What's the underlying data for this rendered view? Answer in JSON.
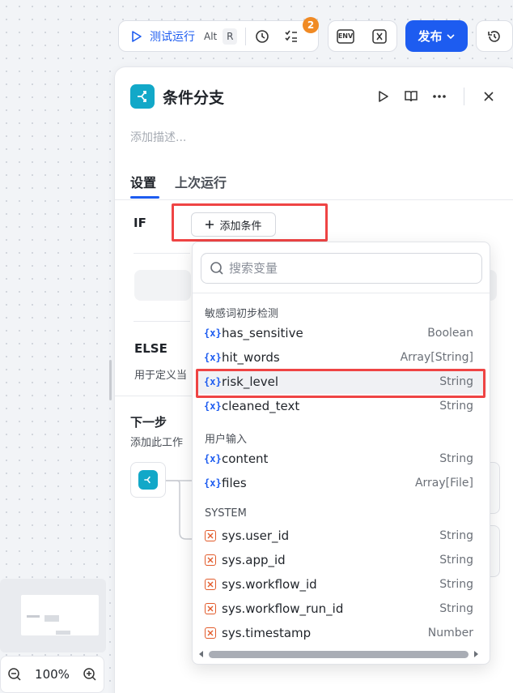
{
  "toolbar": {
    "run_label": "测试运行",
    "shortcut_keys": [
      "Alt",
      "R"
    ],
    "badge_count": "2",
    "env_label": "ENV",
    "publish_label": "发布"
  },
  "panel": {
    "title": "条件分支",
    "description_placeholder": "添加描述...",
    "tabs": [
      {
        "label": "设置",
        "active": true
      },
      {
        "label": "上次运行",
        "active": false
      }
    ],
    "if_label": "IF",
    "add_condition_label": "添加条件",
    "else_label": "ELSE",
    "else_desc": "用于定义当",
    "next_step_title": "下一步",
    "next_step_desc": "添加此工作"
  },
  "dropdown": {
    "search_placeholder": "搜索变量",
    "groups": [
      {
        "label": "敏感词初步检测",
        "items": [
          {
            "name": "has_sensitive",
            "type": "Boolean"
          },
          {
            "name": "hit_words",
            "type": "Array[String]"
          },
          {
            "name": "risk_level",
            "type": "String"
          },
          {
            "name": "cleaned_text",
            "type": "String"
          }
        ]
      },
      {
        "label": "用户输入",
        "items": [
          {
            "name": "content",
            "type": "String"
          },
          {
            "name": "files",
            "type": "Array[File]"
          }
        ]
      },
      {
        "label": "SYSTEM",
        "items": [
          {
            "name": "sys.user_id",
            "type": "String"
          },
          {
            "name": "sys.app_id",
            "type": "String"
          },
          {
            "name": "sys.workflow_id",
            "type": "String"
          },
          {
            "name": "sys.workflow_run_id",
            "type": "String"
          },
          {
            "name": "sys.timestamp",
            "type": "Number"
          }
        ]
      }
    ],
    "var_icon_text": "{x}"
  },
  "zoom": {
    "level": "100%"
  },
  "colors": {
    "accent": "#1d5cf0",
    "node": "#12a8c8",
    "highlight_box": "#ef4444",
    "badge": "#f08a24"
  }
}
